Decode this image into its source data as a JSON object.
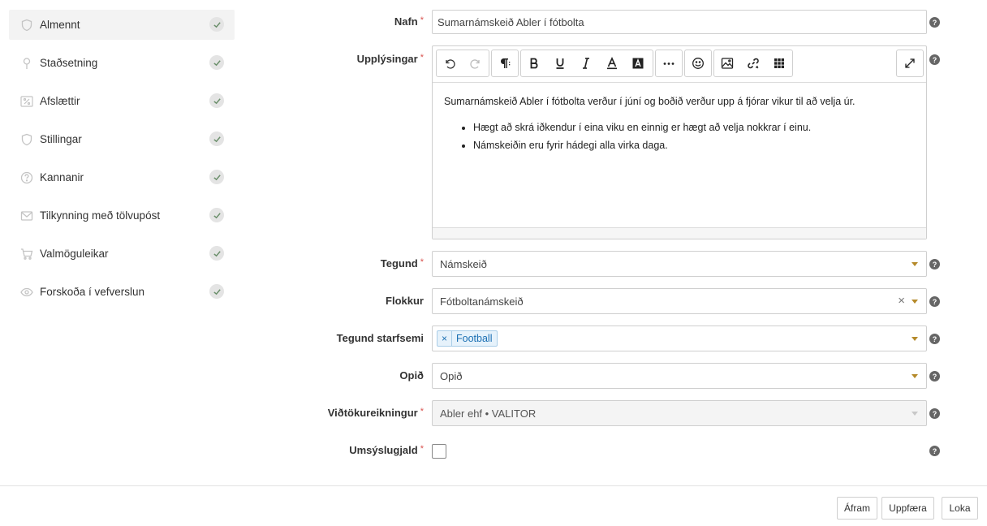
{
  "sidebar": {
    "items": [
      {
        "label": "Almennt",
        "icon": "shield-icon"
      },
      {
        "label": "Staðsetning",
        "icon": "location-pin-icon"
      },
      {
        "label": "Afslættir",
        "icon": "percent-icon"
      },
      {
        "label": "Stillingar",
        "icon": "shield-icon"
      },
      {
        "label": "Kannanir",
        "icon": "question-circle-icon"
      },
      {
        "label": "Tilkynning með tölvupóst",
        "icon": "envelope-icon"
      },
      {
        "label": "Valmöguleikar",
        "icon": "cart-icon"
      },
      {
        "label": "Forskoða í vefverslun",
        "icon": "eye-icon"
      }
    ]
  },
  "form": {
    "name": {
      "label": "Nafn",
      "value": "Sumarnámskeið Abler í fótbolta"
    },
    "info": {
      "label": "Upplýsingar",
      "paragraph": "Sumarnámskeið Abler í fótbolta verður í júní og boðið verður upp á fjórar vikur til að velja úr.",
      "bullets": [
        "Hægt að skrá iðkendur í eina viku en einnig er hægt að velja nokkrar í einu.",
        "Námskeiðin eru fyrir hádegi alla virka daga."
      ]
    },
    "type": {
      "label": "Tegund",
      "value": "Námskeið"
    },
    "category": {
      "label": "Flokkur",
      "value": "Fótboltanámskeið"
    },
    "activity": {
      "label": "Tegund starfsemi",
      "tag": "Football",
      "tag_remove": "×"
    },
    "open": {
      "label": "Opið",
      "value": "Opið"
    },
    "account": {
      "label": "Viðtökureikningur",
      "value": "Abler ehf • VALITOR"
    },
    "fee": {
      "label": "Umsýslugjald"
    },
    "required_mark": "*",
    "help_glyph": "?",
    "clear_glyph": "×"
  },
  "footer": {
    "next": "Áfram",
    "update": "Uppfæra",
    "close": "Loka"
  },
  "colors": {
    "required": "#d9534f",
    "caret": "#b58a2a",
    "tag_bg": "#e6f2fb",
    "tag_text": "#1a6fb3"
  }
}
